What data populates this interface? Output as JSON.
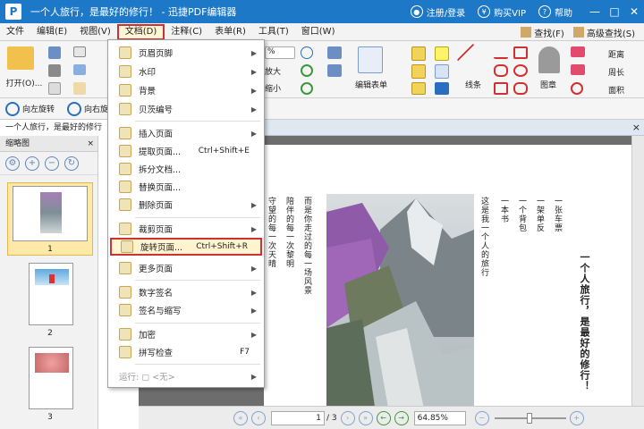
{
  "window": {
    "title": "一个人旅行，是最好的修行！ - 迅捷PDF编辑器",
    "logo": "P",
    "login": "注册/登录",
    "vip": "购买VIP",
    "help": "帮助",
    "minimize": "—",
    "maximize": "□",
    "close": "✕"
  },
  "menubar": {
    "items": [
      "文件",
      "编辑(E)",
      "视图(V)",
      "文档(D)",
      "注释(C)",
      "表单(R)",
      "工具(T)",
      "窗口(W)"
    ],
    "active_index": 3,
    "find": "查找(F)",
    "advanced_find": "高级查找(S)"
  },
  "toolbar": {
    "open_label": "打开(O)...",
    "zoom_percent": "%",
    "enlarge": "放大",
    "shrink": "缩小",
    "edit_form": "编辑表单",
    "lines": "线条",
    "stamp": "图章",
    "distance": "距离",
    "perimeter": "周长",
    "area": "面积"
  },
  "secondbar": {
    "rotate_left": "向左旋转",
    "rotate_right": "向右旋转"
  },
  "tab": {
    "doc_name": "一个人旅行，是最好的修行",
    "close": "×",
    "strip_close": "×"
  },
  "left_panel": {
    "title": "缩略图",
    "close": "×",
    "thumbs": [
      "1",
      "2",
      "3"
    ]
  },
  "page_text": {
    "col1": "一张车票",
    "col2": "一架单反",
    "col3": "一个背包",
    "col4": "一本书",
    "col5": "这是我一个人的旅行",
    "col6": "而是你走过的每一场风景",
    "col7": "陪伴的每一次黎明",
    "col8": "守望的每一次天晴",
    "title": "一个人旅行，是最好的修行！"
  },
  "statusbar": {
    "page_current": "1",
    "page_total": "/ 3",
    "zoom": "64.85%"
  },
  "dropdown": {
    "items": [
      {
        "label": "页眉页脚",
        "shortcut": "",
        "arrow": "▶"
      },
      {
        "label": "水印",
        "shortcut": "",
        "arrow": "▶"
      },
      {
        "label": "背景",
        "shortcut": "",
        "arrow": "▶"
      },
      {
        "label": "贝茨编号",
        "shortcut": "",
        "arrow": "▶"
      },
      {
        "label": "插入页面",
        "shortcut": "",
        "arrow": "▶"
      },
      {
        "label": "提取页面...",
        "shortcut": "Ctrl+Shift+E",
        "arrow": ""
      },
      {
        "label": "拆分文档...",
        "shortcut": "",
        "arrow": ""
      },
      {
        "label": "替换页面...",
        "shortcut": "",
        "arrow": ""
      },
      {
        "label": "删除页面",
        "shortcut": "",
        "arrow": "▶"
      },
      {
        "label": "裁剪页面",
        "shortcut": "",
        "arrow": "▶"
      },
      {
        "label": "旋转页面...",
        "shortcut": "Ctrl+Shift+R",
        "arrow": ""
      },
      {
        "label": "更多页面",
        "shortcut": "",
        "arrow": "▶"
      },
      {
        "label": "数字签名",
        "shortcut": "",
        "arrow": "▶"
      },
      {
        "label": "签名与缩写",
        "shortcut": "",
        "arrow": "▶"
      },
      {
        "label": "加密",
        "shortcut": "",
        "arrow": "▶"
      },
      {
        "label": "拼写检查",
        "shortcut": "F7",
        "arrow": ""
      },
      {
        "label": "运行: ▢ <无>",
        "shortcut": "",
        "arrow": "▶"
      }
    ],
    "highlight_index": 10
  }
}
